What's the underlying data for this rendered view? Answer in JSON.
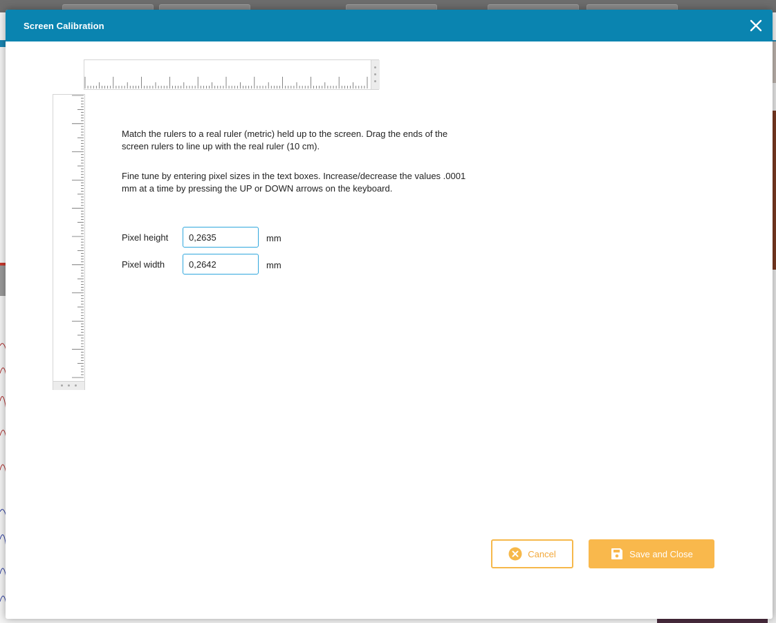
{
  "dialog": {
    "title": "Screen Calibration",
    "close_icon": "close-icon"
  },
  "instructions": {
    "paragraph1": "Match the rulers to a real ruler (metric) held up to the screen. Drag the ends of the screen rulers to line up with the real ruler (10 cm).",
    "paragraph2": "Fine tune by entering pixel sizes in the text boxes. Increase/decrease the values .0001 mm at a time by pressing the UP or DOWN arrows on the keyboard."
  },
  "fields": {
    "pixel_height": {
      "label": "Pixel height",
      "value": "0,2635",
      "unit": "mm"
    },
    "pixel_width": {
      "label": "Pixel width",
      "value": "0,2642",
      "unit": "mm"
    }
  },
  "buttons": {
    "cancel": {
      "label": "Cancel",
      "icon": "cancel-circle-icon"
    },
    "save": {
      "label": "Save and Close",
      "icon": "floppy-disk-icon"
    }
  },
  "colors": {
    "header": "#0a84b0",
    "accent_orange": "#f9b84c",
    "input_border": "#2ea6dd"
  }
}
